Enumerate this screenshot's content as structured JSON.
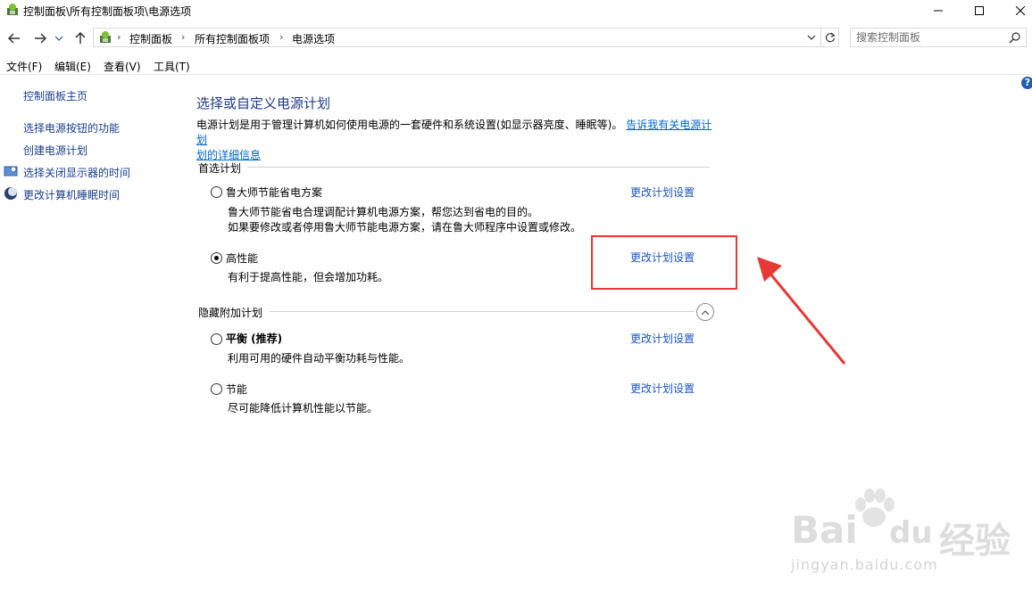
{
  "window": {
    "title": "控制面板\\所有控制面板项\\电源选项",
    "buttons": [
      "minimize",
      "maximize",
      "close"
    ]
  },
  "nav": {
    "breadcrumb": [
      "控制面板",
      "所有控制面板项",
      "电源选项"
    ],
    "search_placeholder": "搜索控制面板"
  },
  "menu": {
    "items": [
      "文件(F)",
      "编辑(E)",
      "查看(V)",
      "工具(T)"
    ]
  },
  "sidebar": {
    "home": "控制面板主页",
    "links": [
      "选择电源按钮的功能",
      "创建电源计划",
      "选择关闭显示器的时间",
      "更改计算机睡眠时间"
    ]
  },
  "main": {
    "heading": "选择或自定义电源计划",
    "description": "电源计划是用于管理计算机如何使用电源的一套硬件和系统设置(如显示器亮度、睡眠等)。",
    "description_link_line1": "告诉我有关电源计划",
    "description_link_line2": "划的详细信息",
    "preferred_group": "首选计划",
    "hidden_group": "隐藏附加计划",
    "plans": [
      {
        "name": "鲁大师节能省电方案",
        "desc1": "鲁大师节能省电合理调配计算机电源方案，帮您达到省电的目的。",
        "desc2": "如果要修改或者停用鲁大师节能电源方案，请在鲁大师程序中设置或修改。",
        "link": "更改计划设置",
        "selected": false
      },
      {
        "name": "高性能",
        "desc1": "有利于提高性能，但会增加功耗。",
        "link": "更改计划设置",
        "selected": true
      },
      {
        "name": "平衡 (推荐)",
        "desc1": "利用可用的硬件自动平衡功耗与性能。",
        "link": "更改计划设置",
        "selected": false
      },
      {
        "name": "节能",
        "desc1": "尽可能降低计算机性能以节能。",
        "link": "更改计划设置",
        "selected": false
      }
    ]
  },
  "annotation": {
    "highlight_color": "#e53935",
    "target": "更改计划设置"
  },
  "watermark": {
    "brand": "Bai",
    "brand2": "du",
    "cn": "经验",
    "url": "jingyan.baidu.com"
  },
  "colors": {
    "link": "#1a55c0",
    "heading": "#1e3a8a",
    "annotation": "#e53935"
  }
}
